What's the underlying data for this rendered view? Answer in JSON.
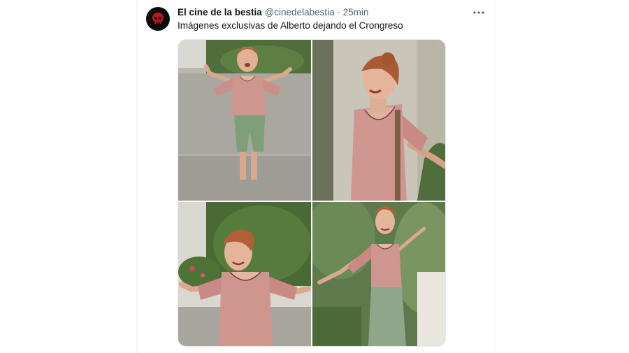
{
  "tweet": {
    "author_name": "El cine de la bestia",
    "author_handle": "@cinedelabestia",
    "separator": "·",
    "timestamp": "25min",
    "text": "Imágenes exclusivas de Alberto dejando el Crongreso",
    "more_icon": "more-horizontal-icon",
    "avatar_icon": "red-skull-logo-icon"
  },
  "colors": {
    "text_primary": "#0f1419",
    "text_secondary": "#536471",
    "avatar_bg": "#0b0b0b",
    "avatar_accent": "#c0181f"
  },
  "media": {
    "photos": [
      {
        "description": "woman walking with arms spread, street background"
      },
      {
        "description": "woman with eyes closed, arms outstretched, close-up"
      },
      {
        "description": "woman smiling, arms out, bushes behind"
      },
      {
        "description": "woman with arms raised, trees behind"
      }
    ]
  }
}
